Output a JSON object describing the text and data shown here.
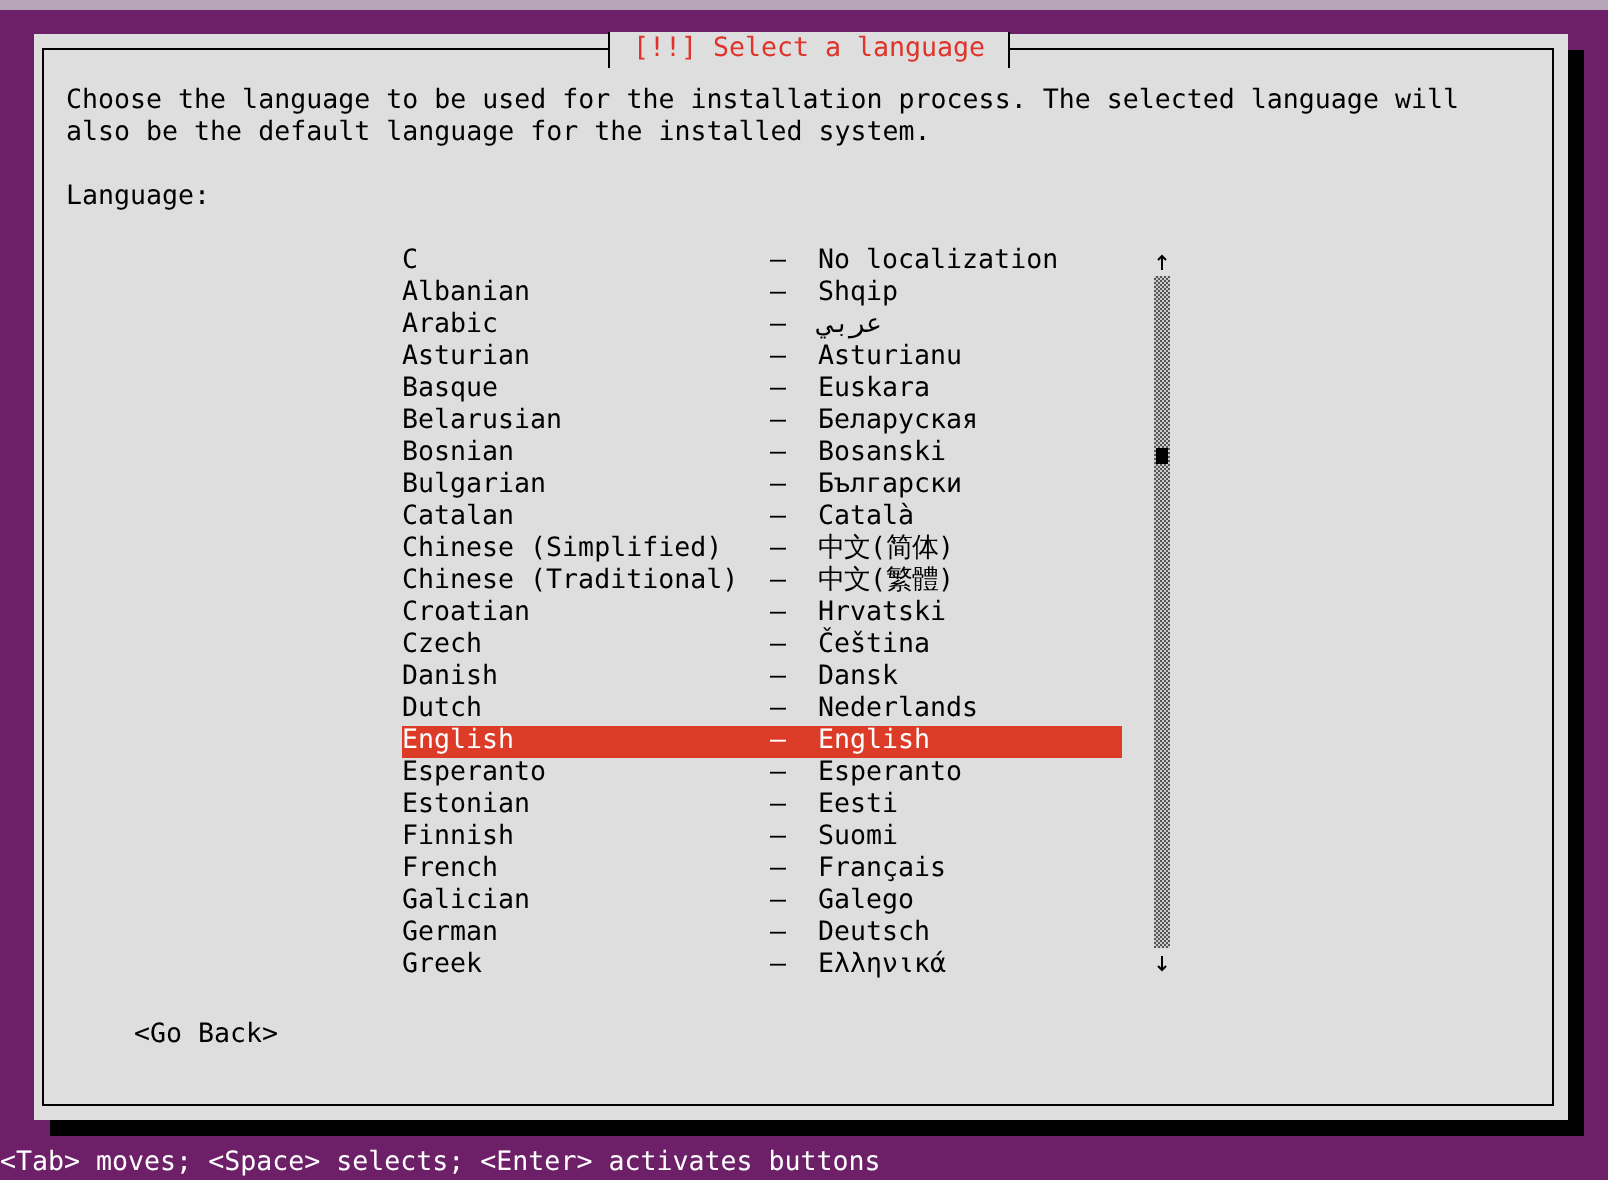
{
  "dialog": {
    "title": "[!!] Select a language",
    "description": "Choose the language to be used for the installation process. The selected language will also be the default language for the installed system.",
    "field_label": "Language:",
    "languages": [
      {
        "name": "C",
        "native": "No localization",
        "selected": false
      },
      {
        "name": "Albanian",
        "native": "Shqip",
        "selected": false
      },
      {
        "name": "Arabic",
        "native": "عربي",
        "selected": false
      },
      {
        "name": "Asturian",
        "native": "Asturianu",
        "selected": false
      },
      {
        "name": "Basque",
        "native": "Euskara",
        "selected": false
      },
      {
        "name": "Belarusian",
        "native": "Беларуская",
        "selected": false
      },
      {
        "name": "Bosnian",
        "native": "Bosanski",
        "selected": false
      },
      {
        "name": "Bulgarian",
        "native": "Български",
        "selected": false
      },
      {
        "name": "Catalan",
        "native": "Català",
        "selected": false
      },
      {
        "name": "Chinese (Simplified)",
        "native": "中文(简体)",
        "selected": false
      },
      {
        "name": "Chinese (Traditional)",
        "native": "中文(繁體)",
        "selected": false
      },
      {
        "name": "Croatian",
        "native": "Hrvatski",
        "selected": false
      },
      {
        "name": "Czech",
        "native": "Čeština",
        "selected": false
      },
      {
        "name": "Danish",
        "native": "Dansk",
        "selected": false
      },
      {
        "name": "Dutch",
        "native": "Nederlands",
        "selected": false
      },
      {
        "name": "English",
        "native": "English",
        "selected": true
      },
      {
        "name": "Esperanto",
        "native": "Esperanto",
        "selected": false
      },
      {
        "name": "Estonian",
        "native": "Eesti",
        "selected": false
      },
      {
        "name": "Finnish",
        "native": "Suomi",
        "selected": false
      },
      {
        "name": "French",
        "native": "Français",
        "selected": false
      },
      {
        "name": "Galician",
        "native": "Galego",
        "selected": false
      },
      {
        "name": "German",
        "native": "Deutsch",
        "selected": false
      },
      {
        "name": "Greek",
        "native": "Ελληνικά",
        "selected": false
      }
    ],
    "separator": "–",
    "back_button": "<Go Back>"
  },
  "status_bar": "<Tab> moves; <Space> selects; <Enter> activates buttons"
}
